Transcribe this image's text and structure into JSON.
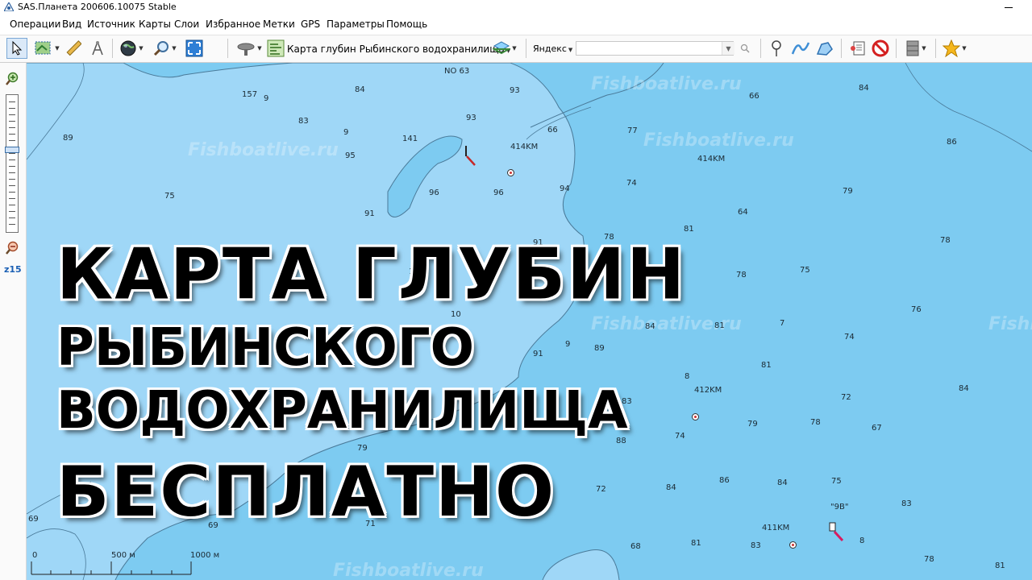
{
  "window": {
    "title": "SAS.Планета 200606.10075 Stable"
  },
  "menu": [
    "Операции",
    "Вид",
    "Источник",
    "Карты",
    "Слои",
    "Избранное",
    "Метки",
    "GPS",
    "Параметры",
    "Помощь"
  ],
  "toolbar": {
    "map_name": "Карта глубин Рыбинского водохранилища",
    "search_provider": "Яндекс",
    "search_value": ""
  },
  "zoom": {
    "level": "z15"
  },
  "map": {
    "watermark": "Fishboatlive.ru",
    "watermark_partial": "Fishb",
    "points": [
      "NO 63",
      "414KM",
      "412KM",
      "411KM",
      "\"9B\""
    ],
    "depths": [
      "157",
      "9",
      "84",
      "93",
      "83",
      "93",
      "66",
      "84",
      "66",
      "89",
      "9",
      "95",
      "141",
      "414KM",
      "77",
      "86",
      "75",
      "96",
      "96",
      "94",
      "74",
      "79",
      "91",
      "64",
      "81",
      "78",
      "91",
      "78",
      "75",
      "78",
      "10",
      "9",
      "10",
      "81",
      "84",
      "7",
      "76",
      "89",
      "91",
      "9",
      "74",
      "8",
      "81",
      "84",
      "83",
      "72",
      "88",
      "79",
      "78",
      "67",
      "74",
      "79",
      "72",
      "84",
      "86",
      "84",
      "75",
      "83",
      "69",
      "69",
      "71",
      "68",
      "81",
      "83",
      "8",
      "78",
      "81"
    ]
  },
  "scale": {
    "zero": "0",
    "mid": "500 м",
    "end": "1000 м"
  },
  "overlay": {
    "line1": "КАРТА ГЛУБИН",
    "line2": "РЫБИНСКОГО",
    "line3": "ВОДОХРАНИЛИЩА",
    "line4": "БЕСПЛАТНО"
  },
  "colors": {
    "deep_water": "#7dcbf1",
    "shallow_water": "#9fd7f7",
    "contour": "#4a7a99",
    "accent": "#1a5fb4"
  }
}
